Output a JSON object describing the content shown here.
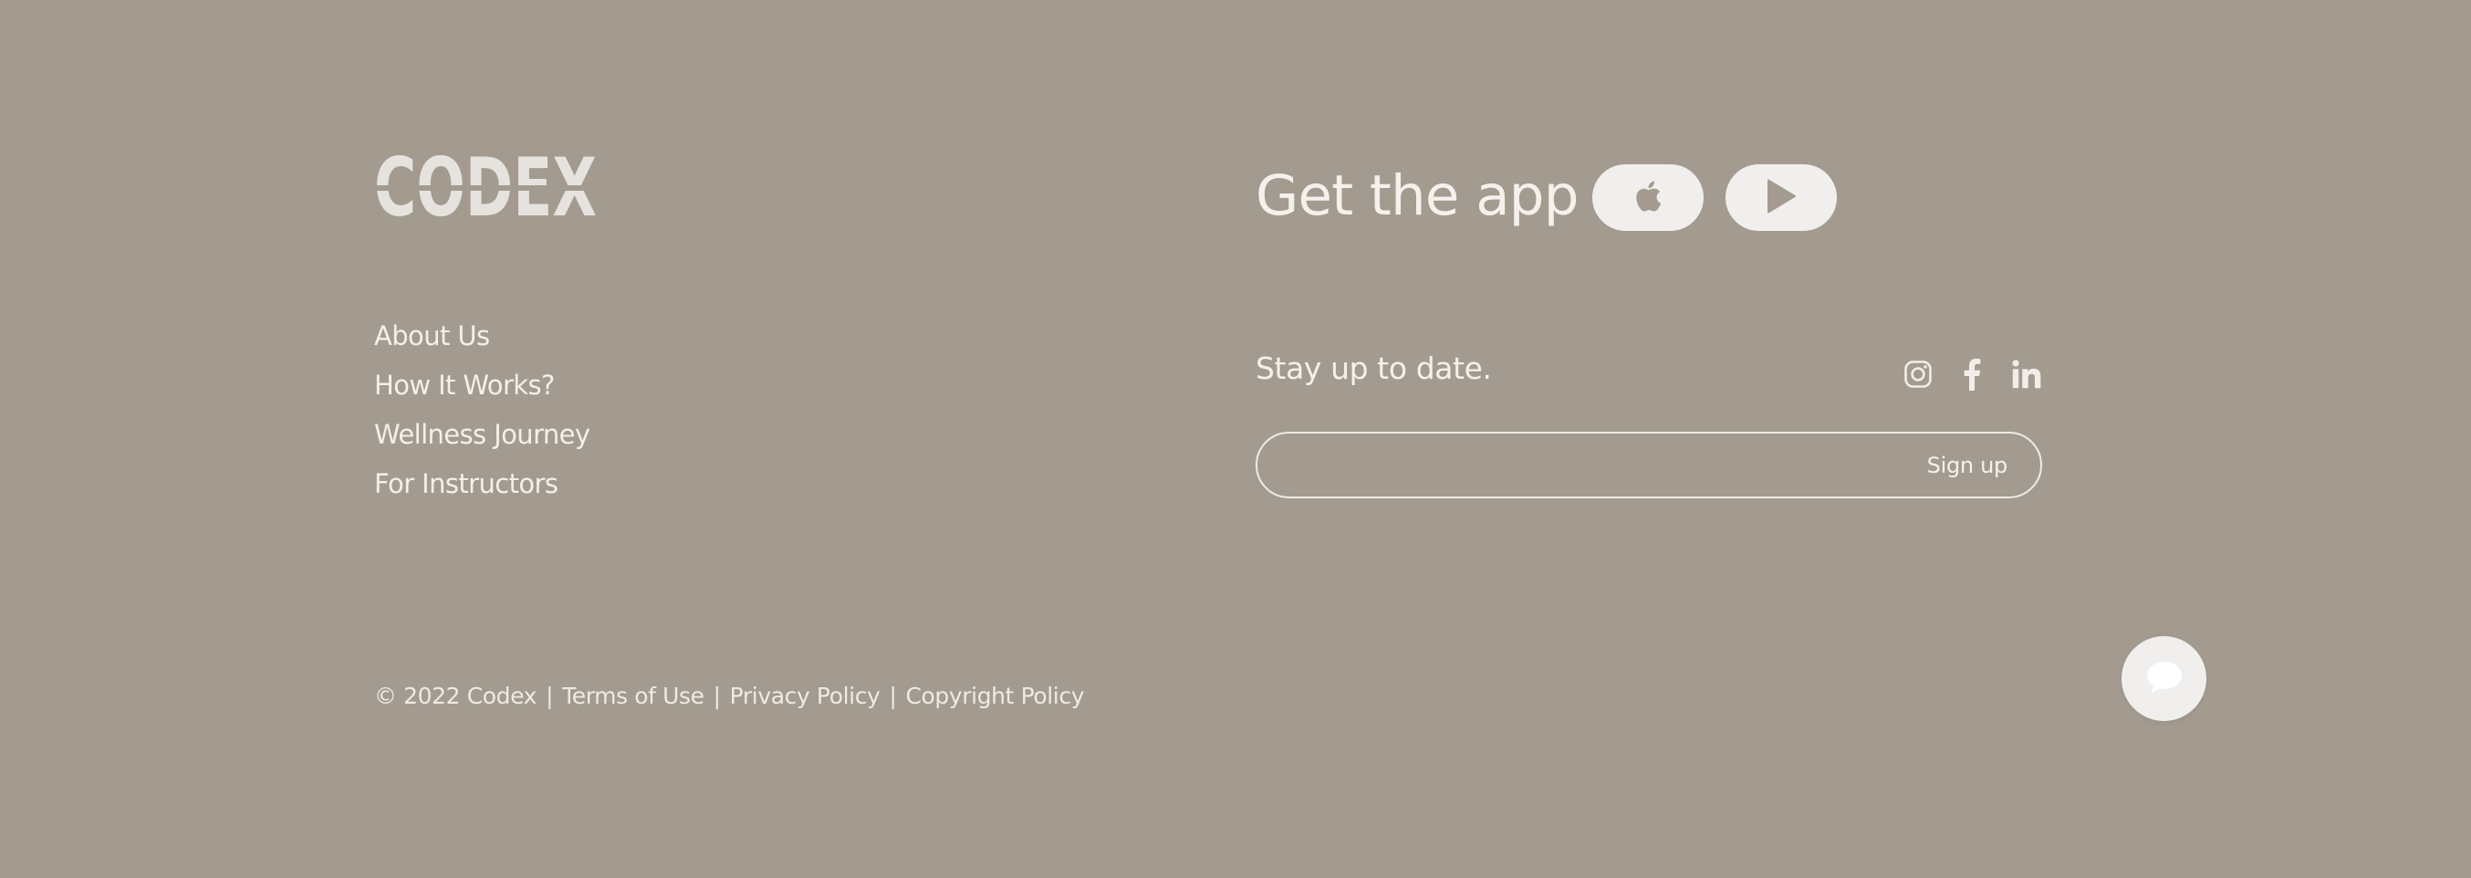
{
  "brand": {
    "name": "CODEX"
  },
  "nav": {
    "items": [
      {
        "label": "About Us"
      },
      {
        "label": "How It Works?"
      },
      {
        "label": "Wellness Journey"
      },
      {
        "label": "For Instructors"
      }
    ]
  },
  "app": {
    "title": "Get the app",
    "stores": [
      {
        "icon": "apple-icon"
      },
      {
        "icon": "play-icon"
      }
    ]
  },
  "newsletter": {
    "title": "Stay up to date.",
    "input_value": "",
    "input_placeholder": "",
    "button_label": "Sign up"
  },
  "social": [
    {
      "icon": "instagram-icon"
    },
    {
      "icon": "facebook-icon"
    },
    {
      "icon": "linkedin-icon"
    }
  ],
  "legal": {
    "copyright": "© 2022 Codex",
    "separator": "|",
    "links": [
      {
        "label": "Terms of Use"
      },
      {
        "label": "Privacy Policy"
      },
      {
        "label": "Copyright Policy"
      }
    ]
  },
  "chat": {
    "icon": "chat-bubble-icon"
  },
  "colors": {
    "background": "#a39b8f",
    "text": "#f1ede8",
    "button_fill": "#f0efed"
  }
}
